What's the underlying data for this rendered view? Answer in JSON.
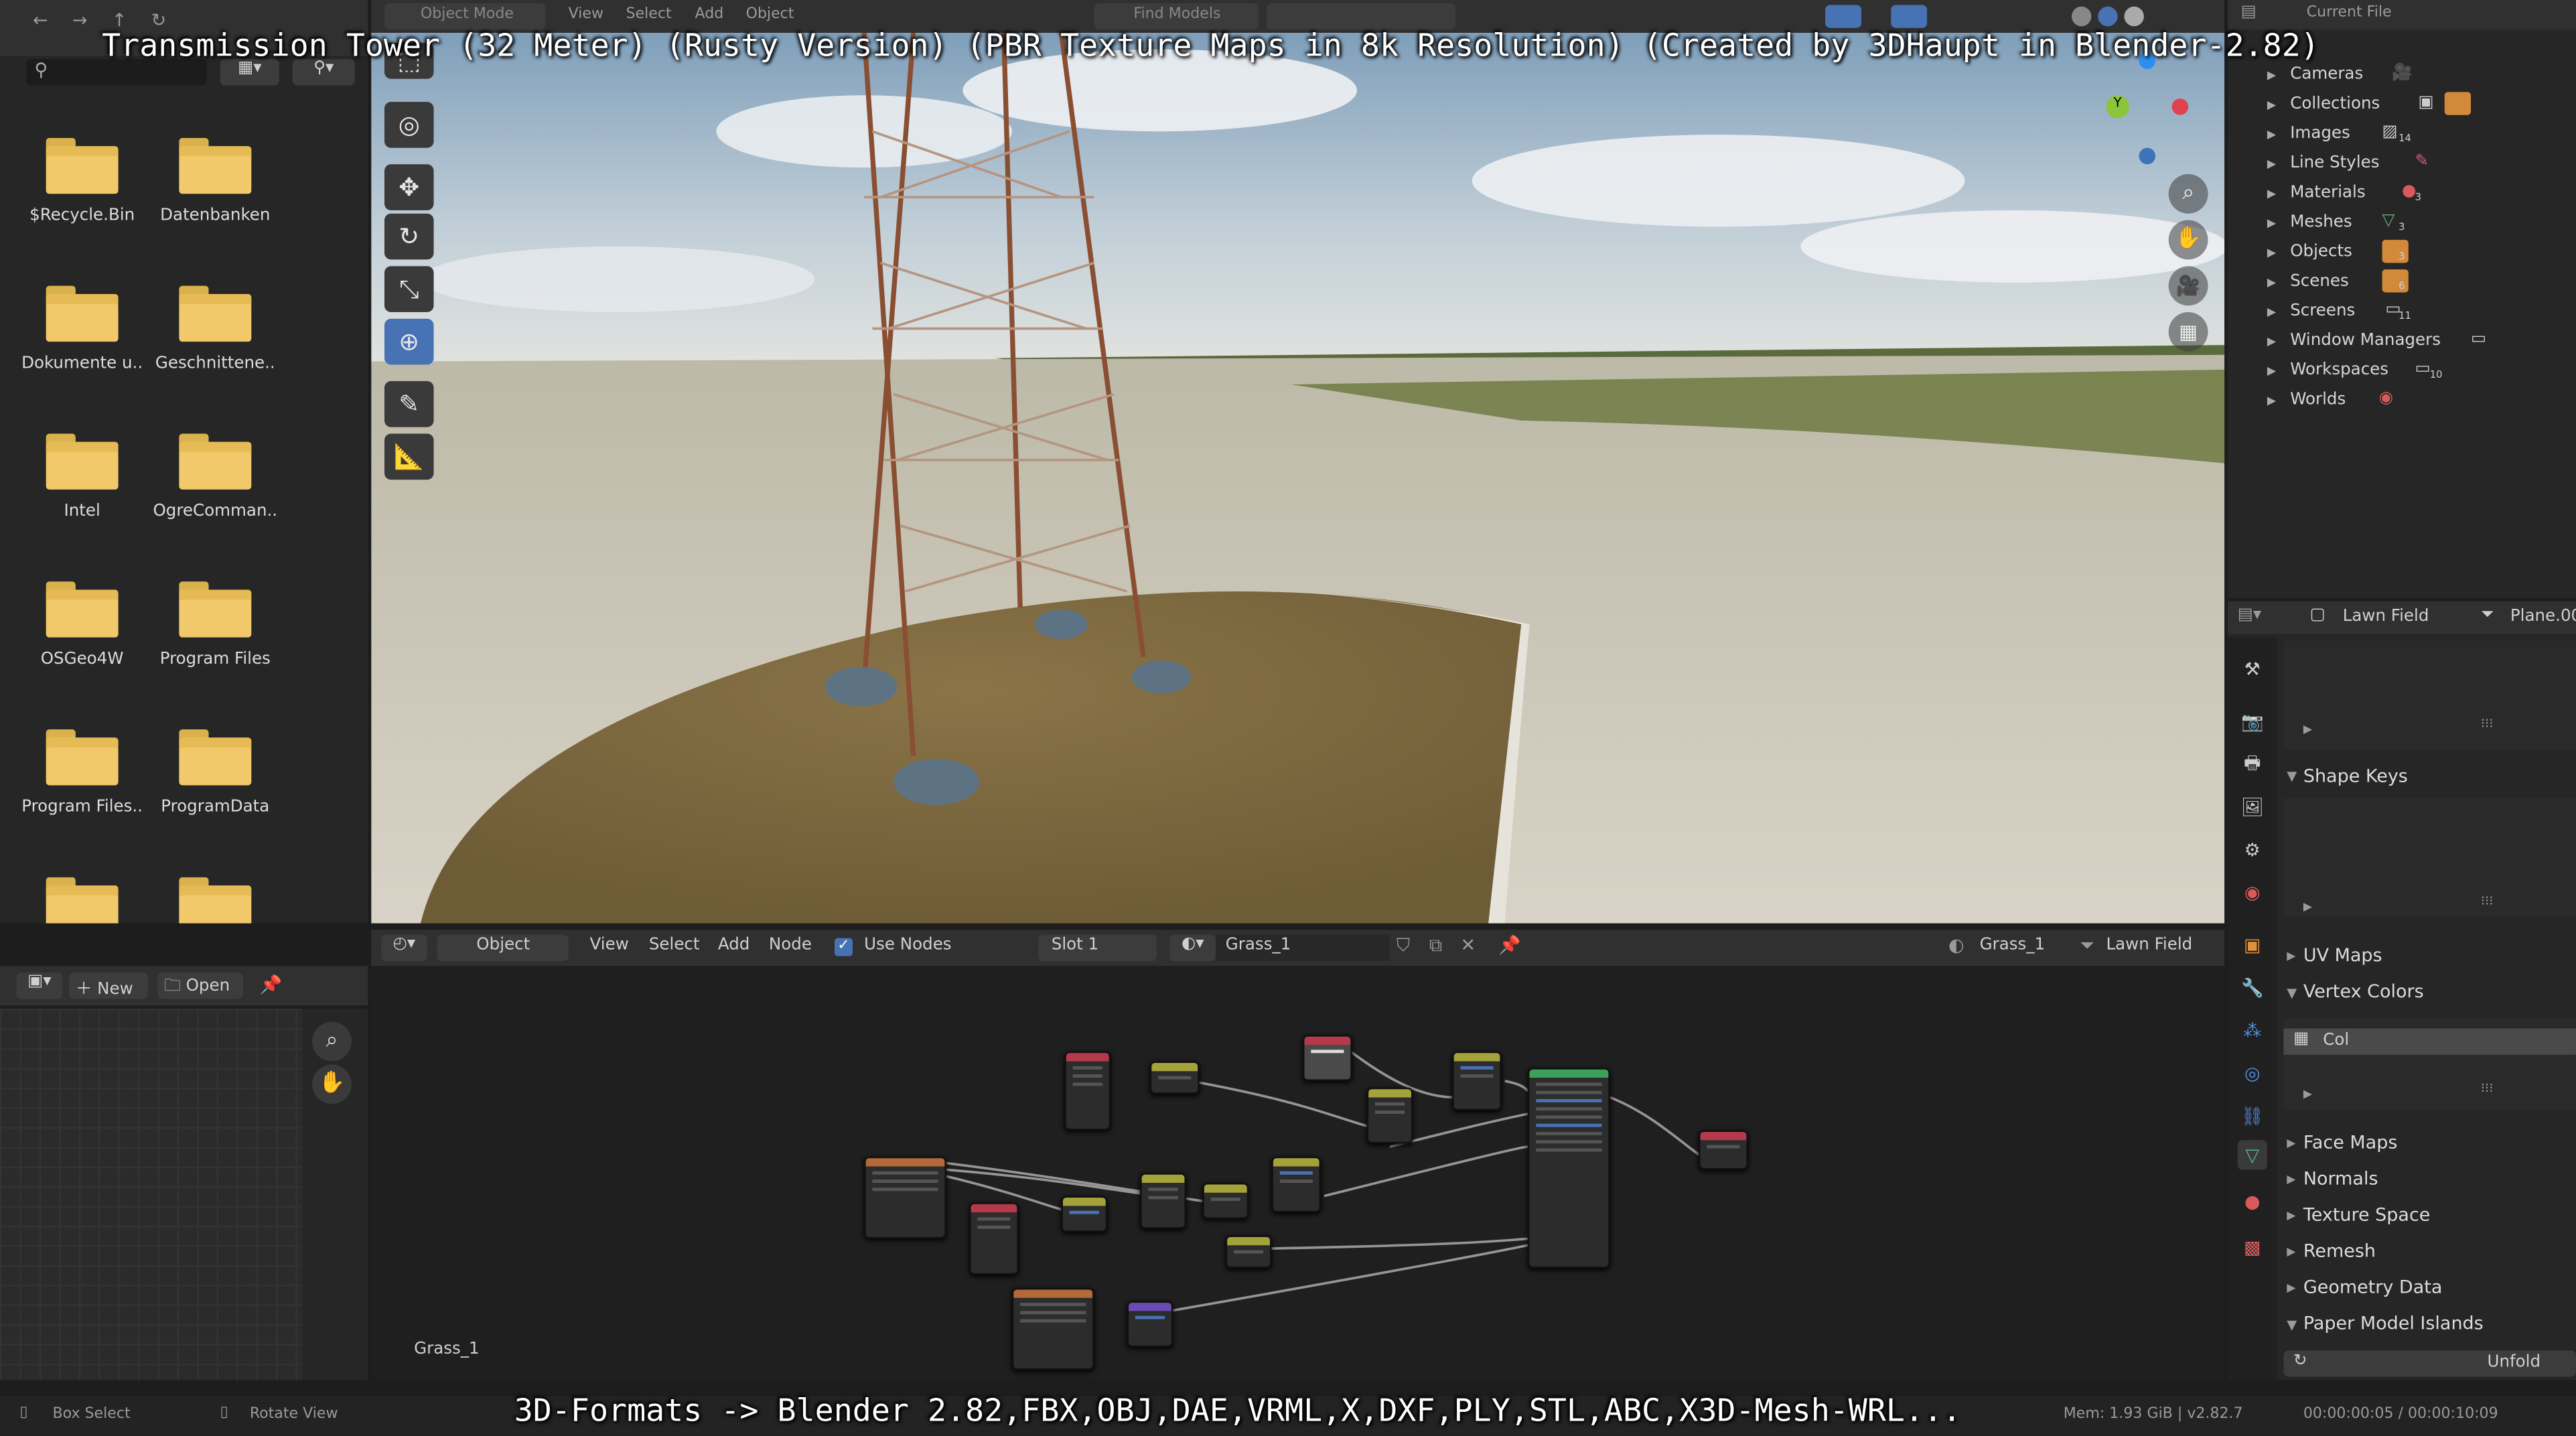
{
  "captions": {
    "title": "Transmission Tower (32 Meter) (Rusty Version) (PBR Texture Maps in 8k Resolution) (Created by 3DHaupt in Blender-2.82)",
    "formats": "3D-Formats -> Blender 2.82,FBX,OBJ,DAE,VRML,X,DXF,PLY,STL,ABC,X3D-Mesh-WRL..."
  },
  "top_header": {
    "mode": "Object Mode",
    "menus": [
      "View",
      "Select",
      "Add",
      "Object"
    ],
    "find_models": "Find Models",
    "current_file": "Current File"
  },
  "file_browser": {
    "folders": [
      "$Recycle.Bin",
      "Datenbanken",
      "Dokumente u..",
      "Geschnittene..",
      "Intel",
      "OgreComman..",
      "OSGeo4W",
      "Program Files",
      "Program Files..",
      "ProgramData",
      "",
      ""
    ]
  },
  "image_editor": {
    "new_label": "New",
    "open_label": "Open"
  },
  "node_editor": {
    "object_label": "Object",
    "menus": [
      "View",
      "Select",
      "Add",
      "Node"
    ],
    "use_nodes": "Use Nodes",
    "slot": "Slot 1",
    "material": "Grass_1",
    "material_right": "Grass_1",
    "object_right": "Lawn Field",
    "frame_label": "Grass_1"
  },
  "outliner": {
    "items": [
      "Cameras",
      "Collections",
      "Images",
      "Line Styles",
      "Materials",
      "Meshes",
      "Objects",
      "Scenes",
      "Screens",
      "Window Managers",
      "Workspaces",
      "Worlds"
    ],
    "badges": {
      "images": "14",
      "materials": "3",
      "meshes": "3",
      "objects": "3",
      "scenes": "6",
      "screens": "11",
      "workspaces": "10"
    }
  },
  "properties": {
    "object_name": "Lawn Field",
    "mesh_name": "Plane.00",
    "sections": {
      "shape_keys": "Shape Keys",
      "uv_maps": "UV Maps",
      "vertex_colors": "Vertex Colors",
      "vertex_color_item": "Col",
      "face_maps": "Face Maps",
      "normals": "Normals",
      "texture_space": "Texture Space",
      "remesh": "Remesh",
      "geometry_data": "Geometry Data",
      "paper_model_islands": "Paper Model Islands",
      "unfold": "Unfold"
    }
  },
  "status_bar": {
    "box_select": "Box Select",
    "rotate_view": "Rotate View",
    "mem": "Mem: 1.93 GiB | v2.82.7",
    "time": "00:00:00:05 / 00:00:10:09"
  },
  "colors": {
    "accent_blue": "#4772b3",
    "folder_yellow": "#f2c96a",
    "header_bg": "#303030",
    "panel_bg": "#262626"
  }
}
